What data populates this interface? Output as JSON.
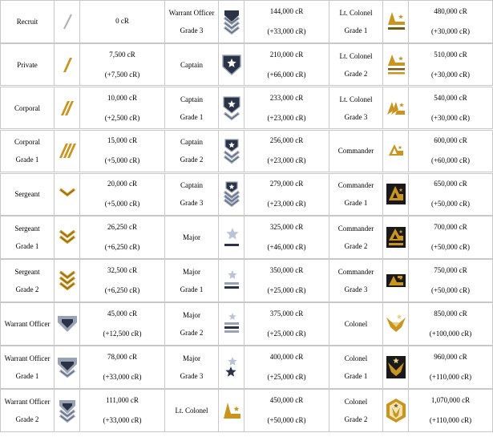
{
  "columns": [
    [
      {
        "name": [
          "Recruit"
        ],
        "cost": "0 cR",
        "delta": "",
        "icon": "slash-thin-icon"
      },
      {
        "name": [
          "Private"
        ],
        "cost": "7,500 cR",
        "delta": "(+7,500 cR)",
        "icon": "stripe-1-icon"
      },
      {
        "name": [
          "Corporal"
        ],
        "cost": "10,000 cR",
        "delta": "(+2,500 cR)",
        "icon": "stripe-2-icon"
      },
      {
        "name": [
          "Corporal",
          "Grade 1"
        ],
        "cost": "15,000 cR",
        "delta": "(+5,000 cR)",
        "icon": "stripe-3-icon"
      },
      {
        "name": [
          "Sergeant"
        ],
        "cost": "20,000 cR",
        "delta": "(+5,000 cR)",
        "icon": "chevron-1-gold-icon"
      },
      {
        "name": [
          "Sergeant",
          "Grade 1"
        ],
        "cost": "26,250 cR",
        "delta": "(+6,250 cR)",
        "icon": "chevron-2-gold-icon"
      },
      {
        "name": [
          "Sergeant",
          "Grade 2"
        ],
        "cost": "32,500 cR",
        "delta": "(+6,250 cR)",
        "icon": "chevron-3-gold-icon"
      },
      {
        "name": [
          "Warrant Officer"
        ],
        "cost": "45,000 cR",
        "delta": "(+12,500 cR)",
        "icon": "chevron-1-silver-icon"
      },
      {
        "name": [
          "Warrant Officer",
          "Grade 1"
        ],
        "cost": "78,000 cR",
        "delta": "(+33,000 cR)",
        "icon": "chevron-2-silver-icon"
      },
      {
        "name": [
          "Warrant Officer",
          "Grade 2"
        ],
        "cost": "111,000 cR",
        "delta": "(+33,000 cR)",
        "icon": "chevron-3-silver-icon"
      }
    ],
    [
      {
        "name": [
          "Warrant Officer",
          "Grade 3"
        ],
        "cost": "144,000 cR",
        "delta": "(+33,000 cR)",
        "icon": "chevron-4-silver-icon"
      },
      {
        "name": [
          "Captain"
        ],
        "cost": "210,000 cR",
        "delta": "(+66,000 cR)",
        "icon": "star-shield-icon"
      },
      {
        "name": [
          "Captain",
          "Grade 1"
        ],
        "cost": "233,000 cR",
        "delta": "(+23,000 cR)",
        "icon": "star-shield-1-icon"
      },
      {
        "name": [
          "Captain",
          "Grade 2"
        ],
        "cost": "256,000 cR",
        "delta": "(+23,000 cR)",
        "icon": "star-shield-2-icon"
      },
      {
        "name": [
          "Captain",
          "Grade 3"
        ],
        "cost": "279,000 cR",
        "delta": "(+23,000 cR)",
        "icon": "star-shield-3-icon"
      },
      {
        "name": [
          "Major"
        ],
        "cost": "325,000 cR",
        "delta": "(+46,000 cR)",
        "icon": "star-bar-icon"
      },
      {
        "name": [
          "Major",
          "Grade 1"
        ],
        "cost": "350,000 cR",
        "delta": "(+25,000 cR)",
        "icon": "star-bars-2-icon"
      },
      {
        "name": [
          "Major",
          "Grade 2"
        ],
        "cost": "375,000 cR",
        "delta": "(+25,000 cR)",
        "icon": "star-bars-3-icon"
      },
      {
        "name": [
          "Major",
          "Grade 3"
        ],
        "cost": "400,000 cR",
        "delta": "(+25,000 cR)",
        "icon": "two-stars-icon"
      },
      {
        "name": [
          "Lt. Colonel"
        ],
        "cost": "450,000 cR",
        "delta": "(+50,000 cR)",
        "icon": "gold-wing-icon"
      }
    ],
    [
      {
        "name": [
          "Lt. Colonel",
          "Grade 1"
        ],
        "cost": "480,000 cR",
        "delta": "(+30,000 cR)",
        "icon": "gold-wing-1-icon"
      },
      {
        "name": [
          "Lt. Colonel",
          "Grade 2"
        ],
        "cost": "510,000 cR",
        "delta": "(+30,000 cR)",
        "icon": "gold-wing-2-icon"
      },
      {
        "name": [
          "Lt. Colonel",
          "Grade 3"
        ],
        "cost": "540,000 cR",
        "delta": "(+30,000 cR)",
        "icon": "gold-wing-3-icon"
      },
      {
        "name": [
          "Commander"
        ],
        "cost": "600,000 cR",
        "delta": "(+60,000 cR)",
        "icon": "gold-triangle-icon"
      },
      {
        "name": [
          "Commander",
          "Grade 1"
        ],
        "cost": "650,000 cR",
        "delta": "(+50,000 cR)",
        "icon": "gold-triangle-1-icon"
      },
      {
        "name": [
          "Commander",
          "Grade 2"
        ],
        "cost": "700,000 cR",
        "delta": "(+50,000 cR)",
        "icon": "gold-triangle-2-icon"
      },
      {
        "name": [
          "Commander",
          "Grade 3"
        ],
        "cost": "750,000 cR",
        "delta": "(+50,000 cR)",
        "icon": "gold-triangle-3-icon"
      },
      {
        "name": [
          "Colonel"
        ],
        "cost": "850,000 cR",
        "delta": "(+100,000 cR)",
        "icon": "gold-eagle-icon"
      },
      {
        "name": [
          "Colonel",
          "Grade 1"
        ],
        "cost": "960,000 cR",
        "delta": "(+110,000 cR)",
        "icon": "gold-eagle-badge-icon"
      },
      {
        "name": [
          "Colonel",
          "Grade 2"
        ],
        "cost": "1,070,000 cR",
        "delta": "(+110,000 cR)",
        "icon": "gold-hex-badge-icon"
      }
    ]
  ],
  "colors": {
    "border": "#c8c8c8",
    "gold": "#c9951f",
    "gold_dark": "#7a5a12",
    "silver": "#9aa3b5",
    "navy": "#2a3446"
  }
}
